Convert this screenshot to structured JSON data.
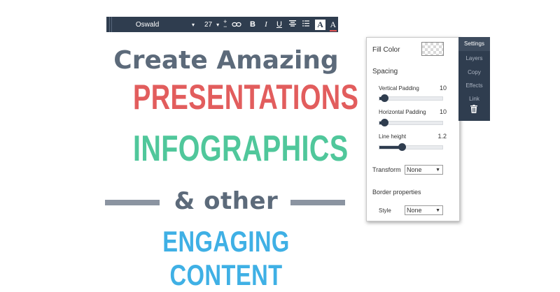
{
  "toolbar": {
    "font": "Oswald",
    "size": "27",
    "plus": "+",
    "minus": "−",
    "link_icon": "link-icon",
    "bold": "B",
    "italic": "I",
    "underline": "U",
    "align_icon": "align-icon",
    "list_icon": "list-icon",
    "text_bg": "A",
    "text_color": "A",
    "caret": "▾"
  },
  "headline": {
    "line1": "Create Amazing",
    "line2": "PRESENTATIONS",
    "line3": "INFOGRAPHICS",
    "line4": "& other",
    "line5": "ENGAGING CONTENT"
  },
  "panel": {
    "fill_color_label": "Fill Color",
    "spacing_label": "Spacing",
    "vertical_padding": {
      "label": "Vertical Padding",
      "value": "10",
      "level": 0.08
    },
    "horizontal_padding": {
      "label": "Horizontal Padding",
      "value": "10",
      "level": 0.08
    },
    "line_height": {
      "label": "Line height",
      "value": "1.2",
      "level": 0.35
    },
    "transform_label": "Transform",
    "transform_value": "None",
    "border_label": "Border properties",
    "style_label": "Style",
    "style_value": "None"
  },
  "tabs": {
    "settings": "Settings",
    "layers": "Layers",
    "copy": "Copy",
    "effects": "Effects",
    "link": "Link"
  },
  "colors": {
    "dark": "#2f3d4f",
    "gray_text": "#5c6a7a",
    "red": "#e25d5d",
    "green": "#50c79b",
    "blue": "#3fb0e5"
  }
}
